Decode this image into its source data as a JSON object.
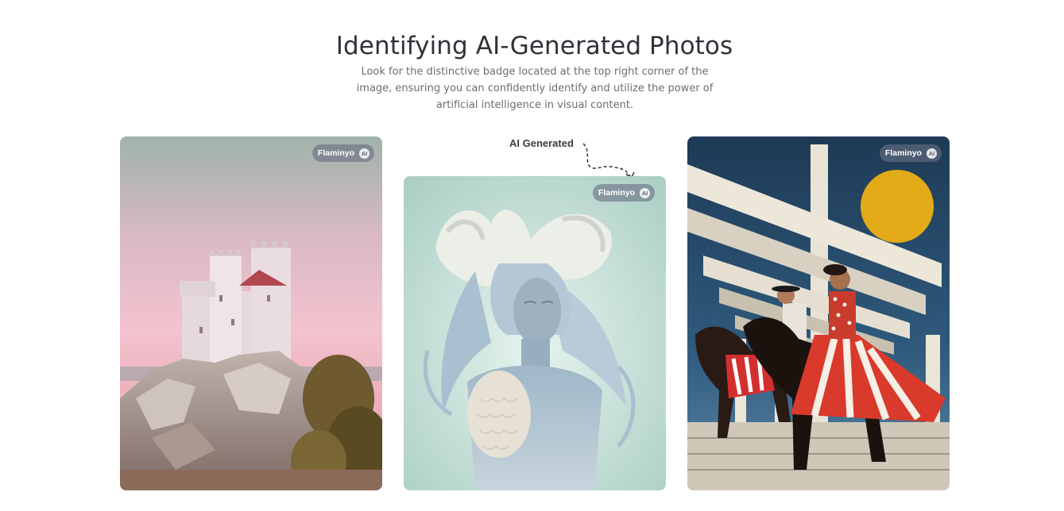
{
  "header": {
    "title": "Identifying AI-Generated Photos",
    "subtitle": "Look for the distinctive badge located at the top right corner of the image, ensuring you can confidently identify and utilize the power of artificial intelligence in visual content."
  },
  "annotation": {
    "label": "AI Generated"
  },
  "badge": {
    "brand": "Flaminyo",
    "ai_mark": "AI"
  },
  "gallery": {
    "cards": [
      {
        "name": "castle-photo"
      },
      {
        "name": "statue-photo"
      },
      {
        "name": "riders-photo"
      }
    ]
  },
  "colors": {
    "title": "#2f3238",
    "subtitle": "#6a6d73",
    "badge_bg": "#697082"
  }
}
